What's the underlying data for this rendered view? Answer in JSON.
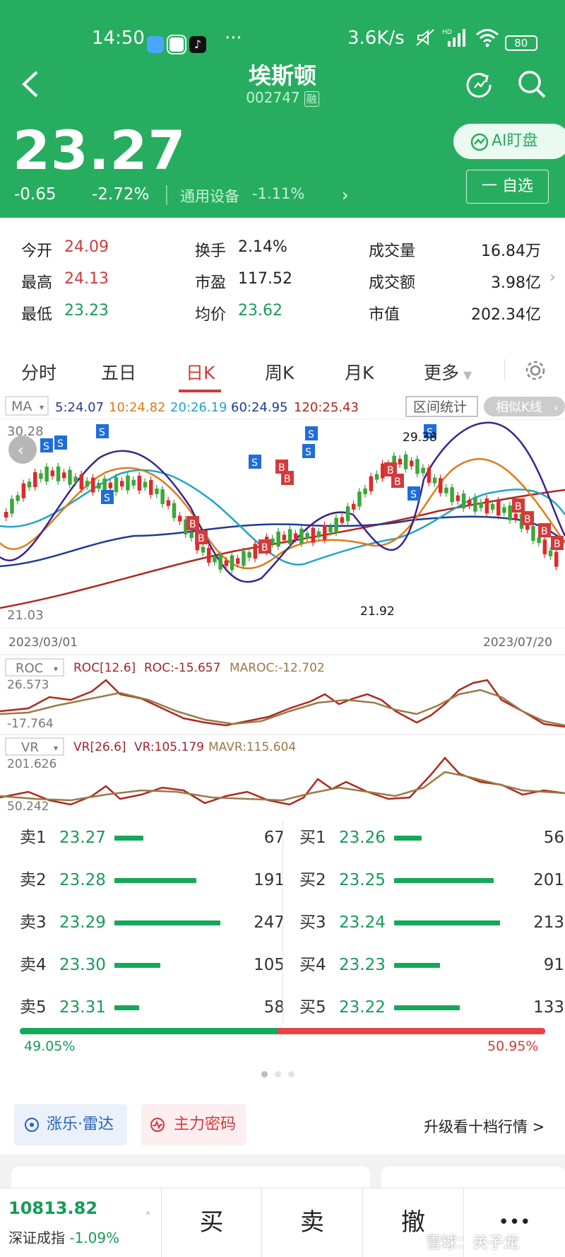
{
  "status": {
    "time": "14:50",
    "net": "3.6K/s",
    "battery": "80"
  },
  "stock": {
    "name": "埃斯顿",
    "code": "002747",
    "margin_badge": "融",
    "price": "23.27",
    "change": "-0.65",
    "change_pct": "-2.72%",
    "sector": "通用设备",
    "sector_pct": "-1.11%",
    "ai_label": "AI盯盘",
    "watch_label": "一 自选"
  },
  "quote": {
    "rows": [
      [
        {
          "label": "今开",
          "value": "24.09"
        },
        {
          "label": "换手",
          "value": "2.14%"
        },
        {
          "label": "成交量",
          "value": "16.84万"
        }
      ],
      [
        {
          "label": "最高",
          "value": "24.13"
        },
        {
          "label": "市盈",
          "value": "117.52"
        },
        {
          "label": "成交额",
          "value": "3.98亿"
        }
      ],
      [
        {
          "label": "最低",
          "value": "23.23"
        },
        {
          "label": "均价",
          "value": "23.62"
        },
        {
          "label": "市值",
          "value": "202.34亿"
        }
      ]
    ]
  },
  "tabs": [
    "分时",
    "五日",
    "日K",
    "周K",
    "月K",
    "更多"
  ],
  "kline": {
    "ma_selector": "MA",
    "ma5": "5:24.07",
    "ma10": "10:24.82",
    "ma20": "20:26.19",
    "ma60": "60:24.95",
    "ma120": "120:25.43",
    "range_btn": "区间统计",
    "similar_btn": "相似K线",
    "y_max": "30.28",
    "y_min": "21.03",
    "high_label": "29.38",
    "low_label": "21.92",
    "date_start": "2023/03/01",
    "date_end": "2023/07/20"
  },
  "roc": {
    "selector": "ROC",
    "params": "ROC[12.6]",
    "roc": "ROC:-15.657",
    "maroc": "MAROC:-12.702",
    "y_max": "26.573",
    "y_min": "-17.764"
  },
  "vr": {
    "selector": "VR",
    "params": "VR[26.6]",
    "vr": "VR:105.179",
    "mavr": "MAVR:115.604",
    "y_max": "201.626",
    "y_min": "50.242"
  },
  "orderbook": {
    "sell": [
      {
        "label": "卖1",
        "price": "23.27",
        "vol": "67",
        "frac": 0.27
      },
      {
        "label": "卖2",
        "price": "23.28",
        "vol": "191",
        "frac": 0.77
      },
      {
        "label": "卖3",
        "price": "23.29",
        "vol": "247",
        "frac": 1.0
      },
      {
        "label": "卖4",
        "price": "23.30",
        "vol": "105",
        "frac": 0.43
      },
      {
        "label": "卖5",
        "price": "23.31",
        "vol": "58",
        "frac": 0.23
      }
    ],
    "buy": [
      {
        "label": "买1",
        "price": "23.26",
        "vol": "56",
        "frac": 0.26
      },
      {
        "label": "买2",
        "price": "23.25",
        "vol": "201",
        "frac": 0.94
      },
      {
        "label": "买3",
        "price": "23.24",
        "vol": "213",
        "frac": 1.0
      },
      {
        "label": "买4",
        "price": "23.23",
        "vol": "91",
        "frac": 0.43
      },
      {
        "label": "买5",
        "price": "23.22",
        "vol": "133",
        "frac": 0.62
      }
    ],
    "sell_ratio": "49.05%",
    "buy_ratio": "50.95%",
    "sell_frac": 0.4905
  },
  "tools": {
    "radar": "涨乐·雷达",
    "code": "主力密码",
    "upgrade": "升级看十档行情 >"
  },
  "index": {
    "value": "10813.82",
    "name": "深证成指",
    "pct": "-1.09%"
  },
  "actions": {
    "buy": "买",
    "sell": "卖",
    "cancel": "撤",
    "more": "•••"
  },
  "watermark": "雪球：关子龙",
  "colors": {
    "green": "#27ad5f",
    "red": "#d23b3b"
  }
}
